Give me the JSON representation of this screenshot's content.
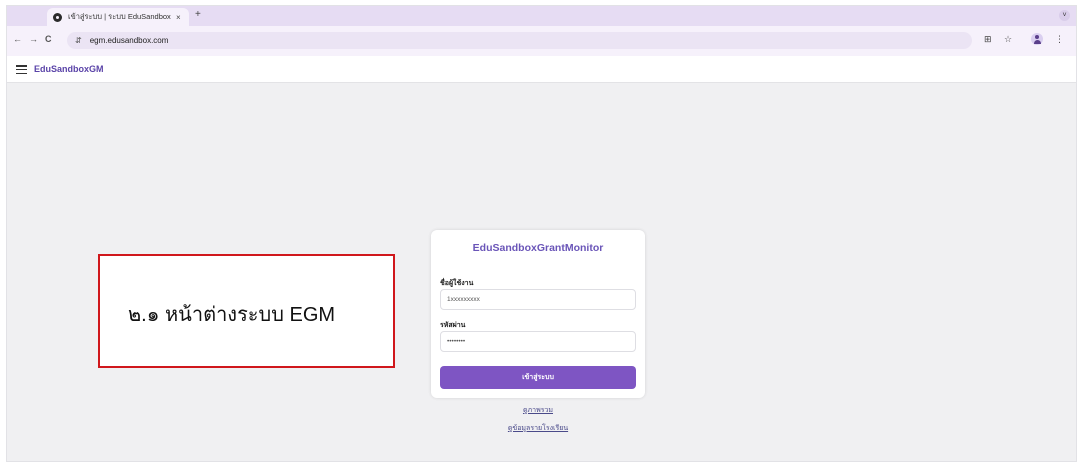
{
  "browser": {
    "tab": {
      "title": "เข้าสู่ระบบ | ระบบ EduSandbox",
      "close": "×",
      "favicon": "edusandbox-favicon-icon"
    },
    "new_tab": "+",
    "tab_menu": "˅",
    "nav": {
      "back": "←",
      "forward": "→",
      "reload": "C"
    },
    "site_info_icon": "⇵",
    "url": "egm.edusandbox.com",
    "translate_icon": "⊞",
    "bookmark_icon": "☆",
    "menu_icon": "⋮"
  },
  "app": {
    "brand": "EduSandboxGM"
  },
  "annotation": {
    "text": "๒.๑ หน้าต่างระบบ EGM",
    "border_color": "#d0171c"
  },
  "login": {
    "title": "EduSandboxGrantMonitor",
    "username_label": "ชื่อผู้ใช้งาน",
    "username_value": "1xxxxxxxxx",
    "password_label": "รหัสผ่าน",
    "password_value": "••••••••",
    "submit_label": "เข้าสู่ระบบ",
    "accent_color": "#7e55c3"
  },
  "links": {
    "overview": "ดูภาพรวม",
    "school_data": "ดูข้อมูลรายโรงเรียน"
  }
}
